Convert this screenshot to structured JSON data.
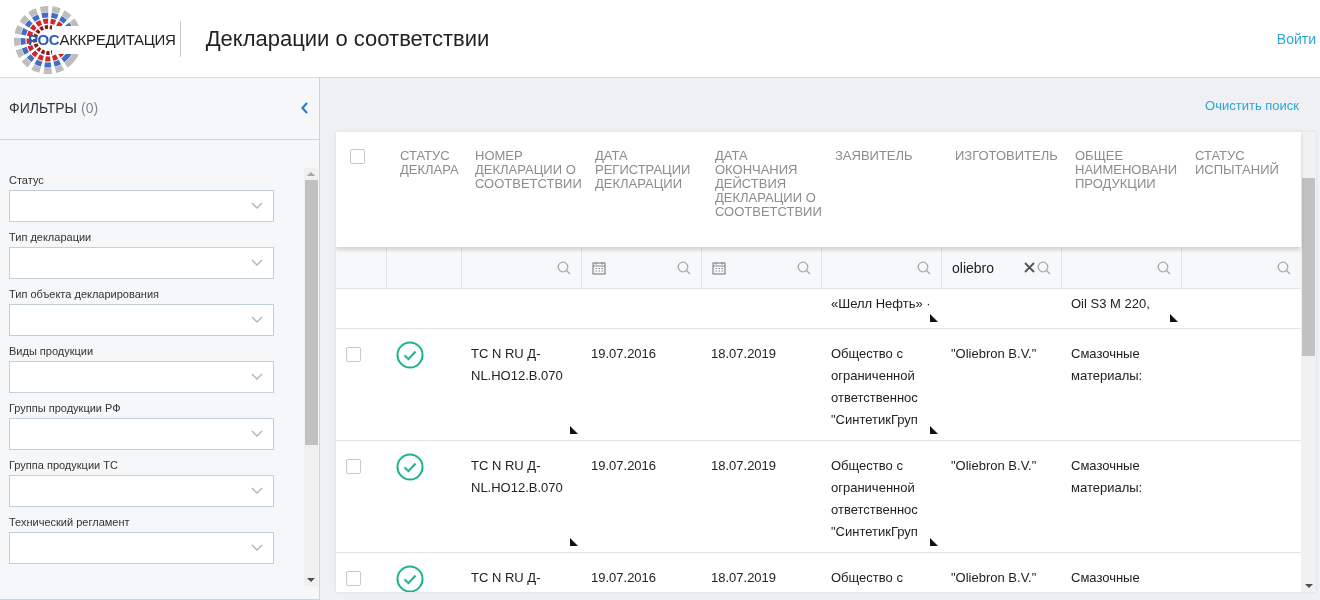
{
  "header": {
    "logo": {
      "accent": "РОС",
      "rest": "АККРЕДИТАЦИЯ"
    },
    "title": "Декларации о соответствии",
    "login": "Войти"
  },
  "sidebar": {
    "title": "ФИЛЬТРЫ",
    "count": "(0)",
    "filters": [
      {
        "label": "Статус"
      },
      {
        "label": "Тип декларации"
      },
      {
        "label": "Тип объекта декларирования"
      },
      {
        "label": "Виды продукции"
      },
      {
        "label": "Группы продукции РФ"
      },
      {
        "label": "Группа продукции ТС"
      },
      {
        "label": "Технический регламент"
      }
    ]
  },
  "clear_search": "Очистить поиск",
  "table": {
    "select_all": {
      "checked": false
    },
    "columns": [
      "СТАТУС ДЕКЛАРА",
      "НОМЕР ДЕКЛАРАЦИИ О СООТВЕТСТВИИ",
      "ДАТА РЕГИСТРАЦИИ ДЕКЛАРАЦИИ",
      "ДАТА ОКОНЧАНИЯ ДЕЙСТВИЯ ДЕКЛАРАЦИИ О СООТВЕТСТВИИ",
      "ЗАЯВИТЕЛЬ",
      "ИЗГОТОВИТЕЛЬ",
      "ОБЩЕЕ НАИМЕНОВАНИ ПРОДУКЦИИ",
      "СТАТУС ИСПЫТАНИЙ"
    ],
    "filters": [
      {
        "kind": "none"
      },
      {
        "kind": "none"
      },
      {
        "kind": "text"
      },
      {
        "kind": "date"
      },
      {
        "kind": "date"
      },
      {
        "kind": "text"
      },
      {
        "kind": "text",
        "value": "oliebro"
      },
      {
        "kind": "text"
      },
      {
        "kind": "text"
      }
    ],
    "rows": [
      {
        "kind": "partial",
        "cells": [
          {
            "kind": "status",
            "valid": false
          },
          {
            "kind": "text",
            "text": "",
            "truncated": false
          },
          {
            "kind": "text",
            "text": "",
            "truncated": false
          },
          {
            "kind": "text",
            "text": "",
            "truncated": false
          },
          {
            "kind": "text",
            "text": "«Шелл Нефть» ·",
            "truncated": true
          },
          {
            "kind": "text",
            "text": "",
            "truncated": false
          },
          {
            "kind": "text",
            "text": "Oil S3 M 220,",
            "truncated": true
          },
          {
            "kind": "text",
            "text": "",
            "truncated": false
          }
        ]
      },
      {
        "kind": "full",
        "checked": false,
        "cells": [
          {
            "kind": "status",
            "valid": true
          },
          {
            "kind": "text",
            "text": "TC N RU Д-NL.HO12.B.070",
            "truncated": true
          },
          {
            "kind": "text",
            "text": "19.07.2016",
            "truncated": false
          },
          {
            "kind": "text",
            "text": "18.07.2019",
            "truncated": false
          },
          {
            "kind": "text",
            "text": "Общество с ограниченной ответственнос \"СинтетикГруп",
            "truncated": true
          },
          {
            "kind": "text",
            "text": "\"Oliebron B.V.\"",
            "truncated": false
          },
          {
            "kind": "text",
            "text": "Смазочные материалы:",
            "truncated": false
          },
          {
            "kind": "text",
            "text": "",
            "truncated": false
          }
        ]
      },
      {
        "kind": "full",
        "checked": false,
        "cells": [
          {
            "kind": "status",
            "valid": true
          },
          {
            "kind": "text",
            "text": "TC N RU Д-NL.HO12.B.070",
            "truncated": true
          },
          {
            "kind": "text",
            "text": "19.07.2016",
            "truncated": false
          },
          {
            "kind": "text",
            "text": "18.07.2019",
            "truncated": false
          },
          {
            "kind": "text",
            "text": "Общество с ограниченной ответственнос \"СинтетикГруп",
            "truncated": true
          },
          {
            "kind": "text",
            "text": "\"Oliebron B.V.\"",
            "truncated": false
          },
          {
            "kind": "text",
            "text": "Смазочные материалы:",
            "truncated": false
          },
          {
            "kind": "text",
            "text": "",
            "truncated": false
          }
        ]
      },
      {
        "kind": "full",
        "checked": false,
        "cells": [
          {
            "kind": "status",
            "valid": true
          },
          {
            "kind": "text",
            "text": "TC N RU Д-",
            "truncated": false
          },
          {
            "kind": "text",
            "text": "19.07.2016",
            "truncated": false
          },
          {
            "kind": "text",
            "text": "18.07.2019",
            "truncated": false
          },
          {
            "kind": "text",
            "text": "Общество с",
            "truncated": false
          },
          {
            "kind": "text",
            "text": "\"Oliebron B.V.\"",
            "truncated": false
          },
          {
            "kind": "text",
            "text": "Смазочные",
            "truncated": false
          },
          {
            "kind": "text",
            "text": "",
            "truncated": false
          }
        ]
      }
    ]
  }
}
